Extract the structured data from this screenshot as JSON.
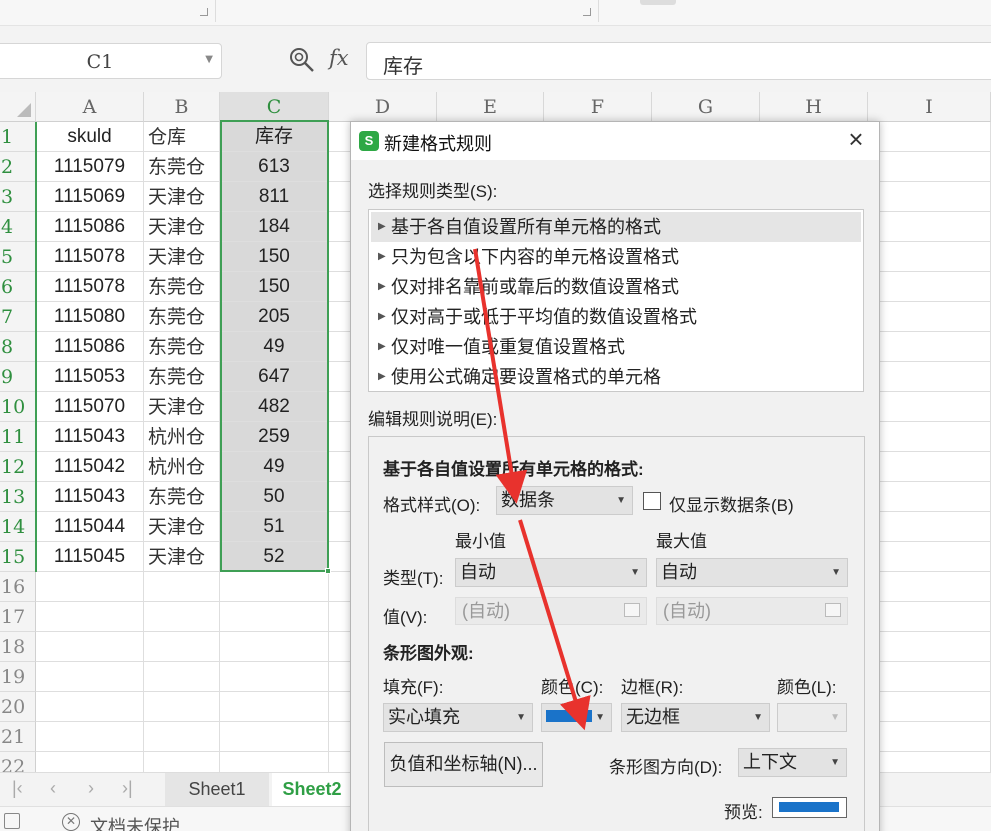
{
  "formula_bar": {
    "name_box": "C1",
    "formula_value": "库存",
    "fx_label": "fx"
  },
  "columns": [
    "A",
    "B",
    "C",
    "D",
    "E",
    "F",
    "G",
    "H",
    "I"
  ],
  "rows": [
    "1",
    "2",
    "3",
    "4",
    "5",
    "6",
    "7",
    "8",
    "9",
    "10",
    "11",
    "12",
    "13",
    "14",
    "15",
    "16",
    "17",
    "18",
    "19",
    "20",
    "21",
    "22"
  ],
  "table": {
    "headers": [
      "skuld",
      "仓库",
      "库存"
    ],
    "data": [
      [
        "1115079",
        "东莞仓",
        "613"
      ],
      [
        "1115069",
        "天津仓",
        "811"
      ],
      [
        "1115086",
        "天津仓",
        "184"
      ],
      [
        "1115078",
        "天津仓",
        "150"
      ],
      [
        "1115078",
        "东莞仓",
        "150"
      ],
      [
        "1115080",
        "东莞仓",
        "205"
      ],
      [
        "1115086",
        "东莞仓",
        "49"
      ],
      [
        "1115053",
        "东莞仓",
        "647"
      ],
      [
        "1115070",
        "天津仓",
        "482"
      ],
      [
        "1115043",
        "杭州仓",
        "259"
      ],
      [
        "1115042",
        "杭州仓",
        "49"
      ],
      [
        "1115043",
        "东莞仓",
        "50"
      ],
      [
        "1115044",
        "天津仓",
        "51"
      ],
      [
        "1115045",
        "天津仓",
        "52"
      ]
    ]
  },
  "sheet_tabs": {
    "sheet1": "Sheet1",
    "sheet2": "Sheet2"
  },
  "status_bar": {
    "protect_text": "文档未保护"
  },
  "dialog": {
    "logo": "S",
    "title": "新建格式规则",
    "select_rule_type_label": "选择规则类型(S):",
    "rule_types": [
      "基于各自值设置所有单元格的格式",
      "只为包含以下内容的单元格设置格式",
      "仅对排名靠前或靠后的数值设置格式",
      "仅对高于或低于平均值的数值设置格式",
      "仅对唯一值或重复值设置格式",
      "使用公式确定要设置格式的单元格"
    ],
    "edit_rule_label": "编辑规则说明(E):",
    "panel_heading": "基于各自值设置所有单元格的格式:",
    "format_style_label": "格式样式(O):",
    "format_style_value": "数据条",
    "show_bar_only_label": "仅显示数据条(B)",
    "min_label": "最小值",
    "max_label": "最大值",
    "type_label": "类型(T):",
    "min_type": "自动",
    "max_type": "自动",
    "value_label": "值(V):",
    "min_value_placeholder": "(自动)",
    "max_value_placeholder": "(自动)",
    "bar_appearance_label": "条形图外观:",
    "fill_label": "填充(F):",
    "fill_color_label": "颜色(C):",
    "border_label": "边框(R):",
    "border_color_label": "颜色(L):",
    "fill_value": "实心填充",
    "border_value": "无边框",
    "neg_axis_button": "负值和坐标轴(N)...",
    "bar_direction_label": "条形图方向(D):",
    "bar_direction_value": "上下文",
    "preview_label": "预览:"
  },
  "colors": {
    "accent_green": "#2f9f45",
    "bar_color": "#1a73c9",
    "arrow_red": "#e8322d"
  }
}
